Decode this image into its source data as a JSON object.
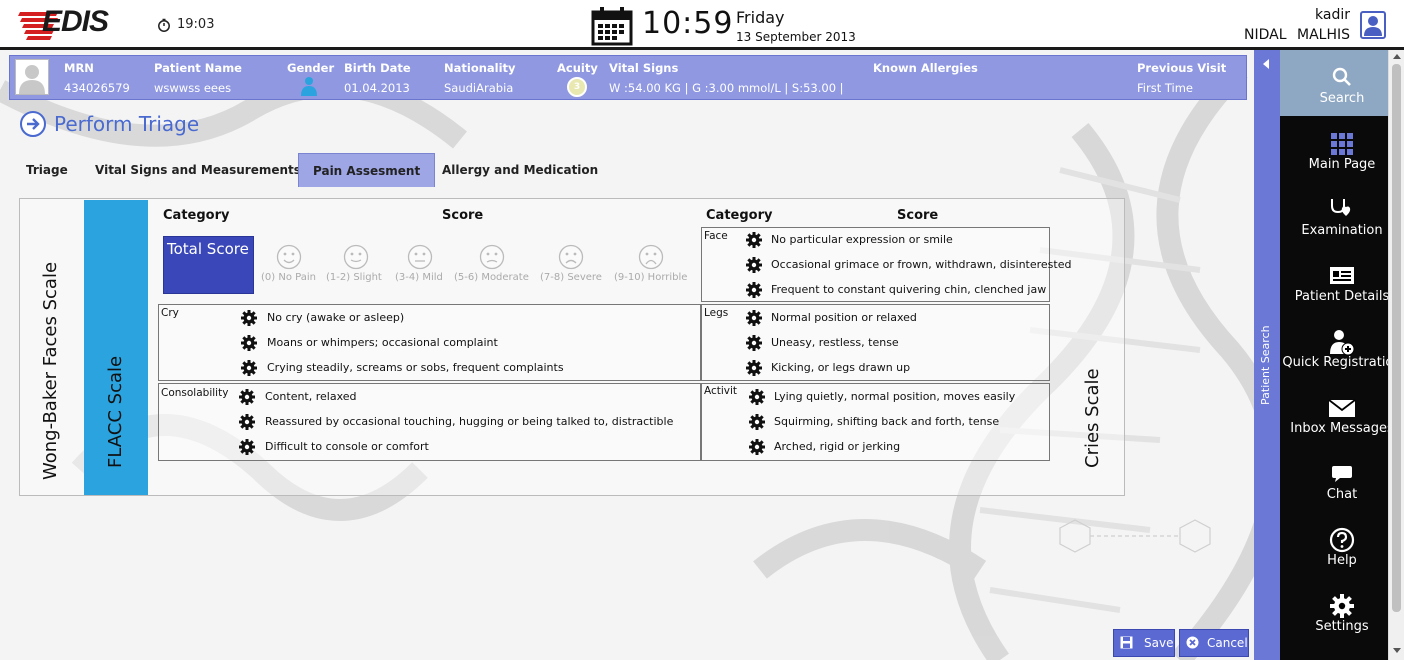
{
  "app": {
    "logo_text": "EDIS",
    "small_time": "19:03",
    "big_time": "10:59",
    "day_name": "Friday",
    "date_full": "13 September 2013"
  },
  "user": {
    "username": "kadir",
    "fullname": "NIDAL  MALHIS"
  },
  "patient": {
    "headers": {
      "mrn": "MRN",
      "name": "Patient Name",
      "gender": "Gender",
      "birth": "Birth Date",
      "nationality": "Nationality",
      "acuity": "Acuity",
      "vitals": "Vital Signs",
      "allergies": "Known Allergies",
      "previous": "Previous Visit"
    },
    "values": {
      "mrn": "434026579",
      "name": "wswwss eees",
      "birth": "01.04.2013",
      "nationality": "SaudiArabia",
      "acuity": "3",
      "vitals": "W :54.00 KG | G :3.00 mmol/L  |  S:53.00 |",
      "allergies": "",
      "previous": "First Time"
    }
  },
  "page": {
    "title": "Perform Triage"
  },
  "tabs": [
    {
      "label": "Triage",
      "active": false
    },
    {
      "label": "Vital Signs and Measurements",
      "active": false
    },
    {
      "label": "Pain Assesment",
      "active": true
    },
    {
      "label": "Allergy and Medication",
      "active": false
    }
  ],
  "pain": {
    "wong_label": "Wong-Baker Faces Scale",
    "flacc_label": "FLACC Scale",
    "cries_label": "Cries Scale",
    "left_category": "Category",
    "left_score": "Score",
    "right_category": "Category",
    "right_score": "Score",
    "total_score": "Total Score",
    "faces": [
      "(0) No Pain",
      "(1-2) Slight",
      "(3-4) Mild",
      "(5-6) Moderate",
      "(7-8) Severe",
      "(9-10) Horrible"
    ],
    "groups": {
      "face": {
        "label": "Face",
        "options": [
          "No particular expression or smile",
          "Occasional grimace or frown, withdrawn, disinterested",
          "Frequent to constant quivering chin, clenched jaw"
        ]
      },
      "cry": {
        "label": "Cry",
        "options": [
          "No cry (awake or asleep)",
          "Moans or whimpers; occasional complaint",
          "Crying steadily, screams or sobs, frequent complaints"
        ]
      },
      "legs": {
        "label": "Legs",
        "options": [
          "Normal position or relaxed",
          "Uneasy, restless, tense",
          "Kicking, or legs drawn up"
        ]
      },
      "consolability": {
        "label": "Consolability",
        "options": [
          "Content, relaxed",
          "Reassured by occasional touching, hugging or being talked to, distractible",
          "Difficult to console or comfort"
        ]
      },
      "activity": {
        "label": "Activit",
        "options": [
          "Lying quietly, normal position, moves easily",
          "Squirming, shifting back and forth, tense",
          "Arched, rigid or jerking"
        ]
      }
    }
  },
  "buttons": {
    "save": "Save",
    "cancel": "Cancel"
  },
  "patient_search_label": "Patient Search",
  "nav": [
    {
      "label": "Search",
      "icon": "search-icon",
      "active": true
    },
    {
      "label": "Main Page",
      "icon": "grid-icon",
      "active": false
    },
    {
      "label": "Examination",
      "icon": "stethoscope-icon",
      "active": false
    },
    {
      "label": "Patient Details",
      "icon": "id-card-icon",
      "active": false
    },
    {
      "label": "Quick Registration",
      "icon": "add-user-icon",
      "active": false
    },
    {
      "label": "Inbox Messages",
      "icon": "envelope-icon",
      "active": false
    },
    {
      "label": "Chat",
      "icon": "chat-icon",
      "active": false
    },
    {
      "label": "Help",
      "icon": "help-icon",
      "active": false
    },
    {
      "label": "Settings",
      "icon": "gear-icon",
      "active": false
    }
  ],
  "colors": {
    "accent": "#5b6ad3",
    "banner": "#8f98e0",
    "flacc": "#2aa3de",
    "nav_bg": "#0a0a0a",
    "active_nav": "#8ea7c2"
  }
}
